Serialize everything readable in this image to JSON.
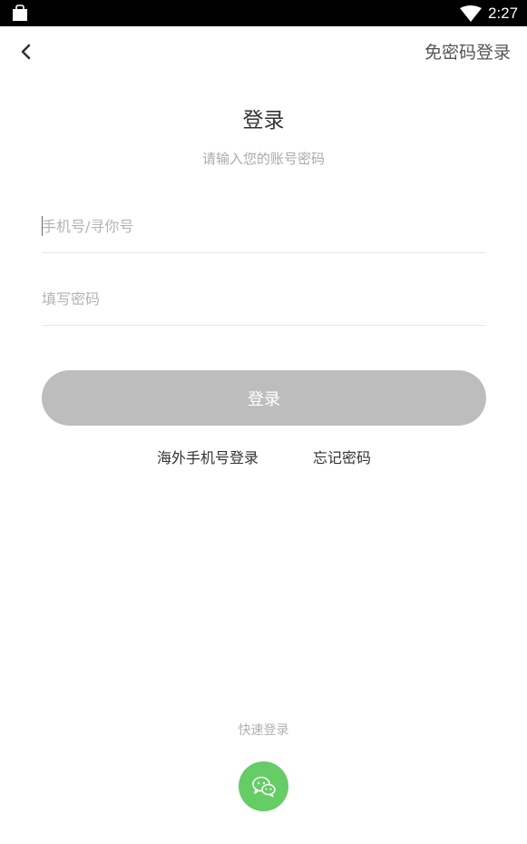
{
  "status_bar": {
    "time": "2:27",
    "left_icon": "shopping-bag-icon",
    "signal_icon": "wifi-icon"
  },
  "header": {
    "back_icon": "chevron-left-icon",
    "switch_link": "免密码登录"
  },
  "main": {
    "title": "登录",
    "subtitle": "请输入您的账号密码",
    "phone_placeholder": "手机号/寻你号",
    "password_placeholder": "填写密码",
    "login_button": "登录",
    "overseas_link": "海外手机号登录",
    "forgot_link": "忘记密码"
  },
  "quick_login": {
    "label": "快速登录",
    "wechat_icon": "wechat-icon"
  },
  "colors": {
    "button_disabled": "#bdbdbd",
    "wechat_green": "#66cc66",
    "status_bar": "#000000"
  }
}
